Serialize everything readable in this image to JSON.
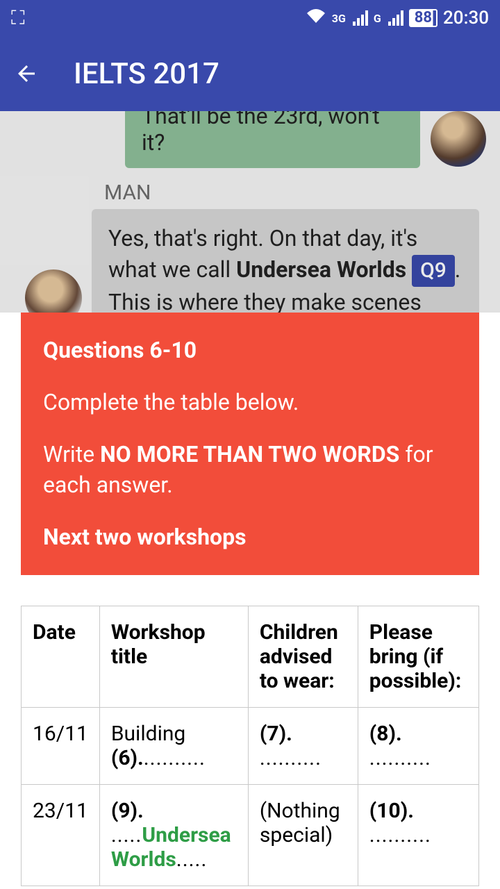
{
  "status": {
    "nets": [
      "3G",
      "G"
    ],
    "battery": "88",
    "time": "20:30"
  },
  "header": {
    "title": "IELTS 2017"
  },
  "chat": {
    "green_bubble": "That'll be the 23rd, won't it?",
    "speaker": "MAN",
    "gray_pre": "Yes, that's right. On that day, it's what we call ",
    "gray_bold": "Undersea Worlds",
    "q_badge": "Q9",
    "gray_post": ". This is where they make scenes with fishes, underground caverns and so"
  },
  "panel": {
    "heading": "Questions 6-10",
    "line2": "Complete the table below.",
    "line3_pre": "Write ",
    "line3_bold": "NO MORE THAN TWO WORDS",
    "line3_post": " for each answer.",
    "sub": "Next two workshops"
  },
  "table": {
    "headers": {
      "c1": "Date",
      "c2": "Workshop title",
      "c3": "Children advised to wear:",
      "c4": "Please bring (if possible):"
    },
    "rows": [
      {
        "date": "16/11",
        "title_pre": "Building ",
        "title_q": "(6).",
        "title_dots": "..........",
        "wear_q": "(7).",
        "wear_dots": " ..........",
        "bring_q": "(8).",
        "bring_dots": " .........."
      },
      {
        "date": "23/11",
        "title_q": "(9).",
        "title_dots_pre": " .....",
        "title_answer": "Undersea Worlds",
        "title_dots_post": ".....",
        "wear": "(Nothing special)",
        "bring_q": "(10).",
        "bring_dots": " .........."
      }
    ]
  }
}
